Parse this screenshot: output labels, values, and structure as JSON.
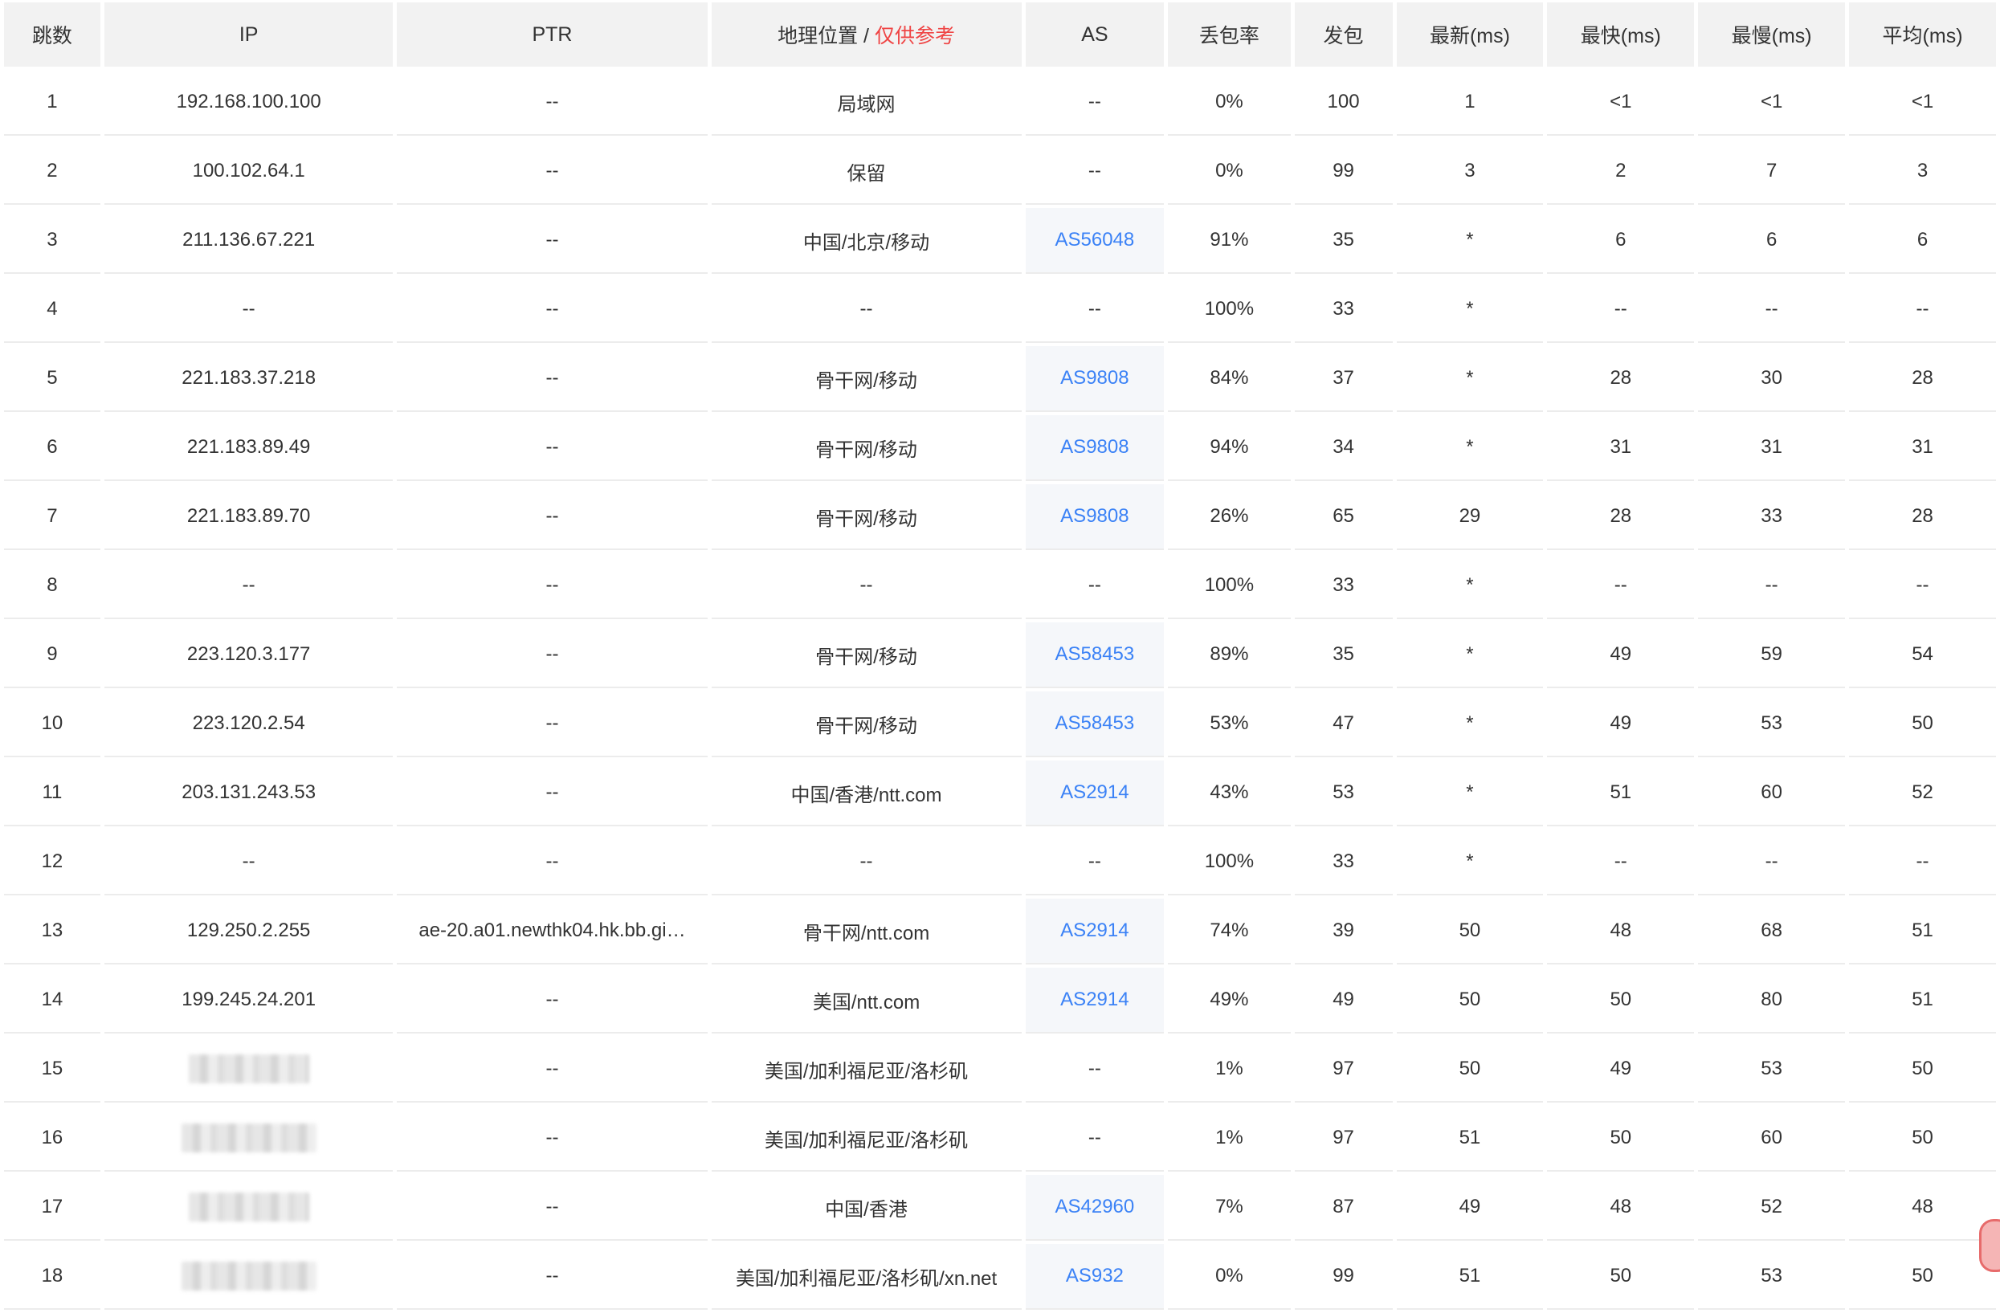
{
  "table": {
    "headers": {
      "hop": "跳数",
      "ip": "IP",
      "ptr": "PTR",
      "geo": "地理位置",
      "geo_sep": " / ",
      "geo_note": "仅供参考",
      "as": "AS",
      "loss": "丢包率",
      "sent": "发包",
      "last": "最新(ms)",
      "best": "最快(ms)",
      "worst": "最慢(ms)",
      "avg": "平均(ms)"
    },
    "rows": [
      {
        "hop": "1",
        "ip": "192.168.100.100",
        "ip_masked": false,
        "ptr": "--",
        "geo": "局域网",
        "as": "--",
        "loss": "0%",
        "sent": "100",
        "last": "1",
        "best": "<1",
        "worst": "<1",
        "avg": "<1"
      },
      {
        "hop": "2",
        "ip": "100.102.64.1",
        "ip_masked": false,
        "ptr": "--",
        "geo": "保留",
        "as": "--",
        "loss": "0%",
        "sent": "99",
        "last": "3",
        "best": "2",
        "worst": "7",
        "avg": "3"
      },
      {
        "hop": "3",
        "ip": "211.136.67.221",
        "ip_masked": false,
        "ptr": "--",
        "geo": "中国/北京/移动",
        "as": "AS56048",
        "loss": "91%",
        "sent": "35",
        "last": "*",
        "best": "6",
        "worst": "6",
        "avg": "6"
      },
      {
        "hop": "4",
        "ip": "--",
        "ip_masked": false,
        "ptr": "--",
        "geo": "--",
        "as": "--",
        "loss": "100%",
        "sent": "33",
        "last": "*",
        "best": "--",
        "worst": "--",
        "avg": "--"
      },
      {
        "hop": "5",
        "ip": "221.183.37.218",
        "ip_masked": false,
        "ptr": "--",
        "geo": "骨干网/移动",
        "as": "AS9808",
        "loss": "84%",
        "sent": "37",
        "last": "*",
        "best": "28",
        "worst": "30",
        "avg": "28"
      },
      {
        "hop": "6",
        "ip": "221.183.89.49",
        "ip_masked": false,
        "ptr": "--",
        "geo": "骨干网/移动",
        "as": "AS9808",
        "loss": "94%",
        "sent": "34",
        "last": "*",
        "best": "31",
        "worst": "31",
        "avg": "31"
      },
      {
        "hop": "7",
        "ip": "221.183.89.70",
        "ip_masked": false,
        "ptr": "--",
        "geo": "骨干网/移动",
        "as": "AS9808",
        "loss": "26%",
        "sent": "65",
        "last": "29",
        "best": "28",
        "worst": "33",
        "avg": "28"
      },
      {
        "hop": "8",
        "ip": "--",
        "ip_masked": false,
        "ptr": "--",
        "geo": "--",
        "as": "--",
        "loss": "100%",
        "sent": "33",
        "last": "*",
        "best": "--",
        "worst": "--",
        "avg": "--"
      },
      {
        "hop": "9",
        "ip": "223.120.3.177",
        "ip_masked": false,
        "ptr": "--",
        "geo": "骨干网/移动",
        "as": "AS58453",
        "loss": "89%",
        "sent": "35",
        "last": "*",
        "best": "49",
        "worst": "59",
        "avg": "54"
      },
      {
        "hop": "10",
        "ip": "223.120.2.54",
        "ip_masked": false,
        "ptr": "--",
        "geo": "骨干网/移动",
        "as": "AS58453",
        "loss": "53%",
        "sent": "47",
        "last": "*",
        "best": "49",
        "worst": "53",
        "avg": "50"
      },
      {
        "hop": "11",
        "ip": "203.131.243.53",
        "ip_masked": false,
        "ptr": "--",
        "geo": "中国/香港/ntt.com",
        "as": "AS2914",
        "loss": "43%",
        "sent": "53",
        "last": "*",
        "best": "51",
        "worst": "60",
        "avg": "52"
      },
      {
        "hop": "12",
        "ip": "--",
        "ip_masked": false,
        "ptr": "--",
        "geo": "--",
        "as": "--",
        "loss": "100%",
        "sent": "33",
        "last": "*",
        "best": "--",
        "worst": "--",
        "avg": "--"
      },
      {
        "hop": "13",
        "ip": "129.250.2.255",
        "ip_masked": false,
        "ptr": "ae-20.a01.newthk04.hk.bb.gi…",
        "geo": "骨干网/ntt.com",
        "as": "AS2914",
        "loss": "74%",
        "sent": "39",
        "last": "50",
        "best": "48",
        "worst": "68",
        "avg": "51"
      },
      {
        "hop": "14",
        "ip": "199.245.24.201",
        "ip_masked": false,
        "ptr": "--",
        "geo": "美国/ntt.com",
        "as": "AS2914",
        "loss": "49%",
        "sent": "49",
        "last": "50",
        "best": "50",
        "worst": "80",
        "avg": "51"
      },
      {
        "hop": "15",
        "ip": "",
        "ip_masked": true,
        "ptr": "--",
        "geo": "美国/加利福尼亚/洛杉矶",
        "as": "--",
        "loss": "1%",
        "sent": "97",
        "last": "50",
        "best": "49",
        "worst": "53",
        "avg": "50"
      },
      {
        "hop": "16",
        "ip": "",
        "ip_masked": true,
        "ptr": "--",
        "geo": "美国/加利福尼亚/洛杉矶",
        "as": "--",
        "loss": "1%",
        "sent": "97",
        "last": "51",
        "best": "50",
        "worst": "60",
        "avg": "50"
      },
      {
        "hop": "17",
        "ip": "",
        "ip_masked": true,
        "ptr": "--",
        "geo": "中国/香港",
        "as": "AS42960",
        "loss": "7%",
        "sent": "87",
        "last": "49",
        "best": "48",
        "worst": "52",
        "avg": "48"
      },
      {
        "hop": "18",
        "ip": "",
        "ip_masked": true,
        "ptr": "--",
        "geo": "美国/加利福尼亚/洛杉矶/xn.net",
        "as": "AS932",
        "loss": "0%",
        "sent": "99",
        "last": "51",
        "best": "50",
        "worst": "53",
        "avg": "50"
      }
    ]
  },
  "colors": {
    "header_bg": "#f2f2f2",
    "as_link": "#3b82f6",
    "warning_text": "#ef4444",
    "as_cell_bg": "#f5f7fa",
    "row_border": "#ececec"
  }
}
